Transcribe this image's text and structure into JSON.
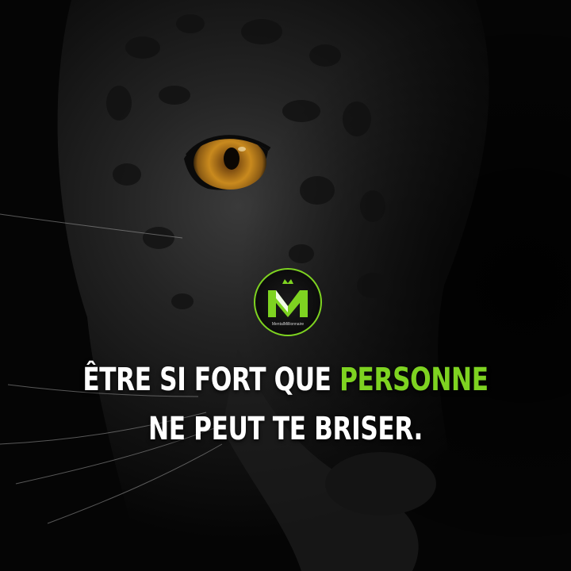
{
  "image": {
    "subject": "black-leopard-face",
    "colors": {
      "background": "#060606",
      "fur": "#2a2a2a",
      "eye_iris": "#c98a1e",
      "accent_green": "#7ed321",
      "text": "#ffffff"
    }
  },
  "logo": {
    "monogram": "M",
    "wordmark": "MentalMillionnaire",
    "icon": "crown-icon"
  },
  "quote": {
    "line1_prefix": "ÊTRE SI FORT QUE ",
    "line1_highlight": "PERSONNE",
    "line2": "NE PEUT TE BRISER."
  }
}
